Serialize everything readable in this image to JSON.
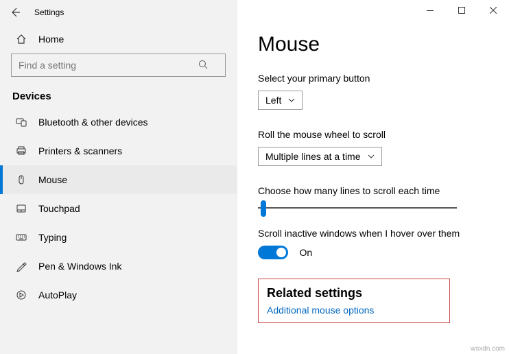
{
  "window": {
    "title": "Settings"
  },
  "sidebar": {
    "home_label": "Home",
    "search_placeholder": "Find a setting",
    "section_header": "Devices",
    "items": [
      {
        "label": "Bluetooth & other devices"
      },
      {
        "label": "Printers & scanners"
      },
      {
        "label": "Mouse"
      },
      {
        "label": "Touchpad"
      },
      {
        "label": "Typing"
      },
      {
        "label": "Pen & Windows Ink"
      },
      {
        "label": "AutoPlay"
      }
    ]
  },
  "content": {
    "heading": "Mouse",
    "primary_button": {
      "label": "Select your primary button",
      "value": "Left"
    },
    "wheel": {
      "label": "Roll the mouse wheel to scroll",
      "value": "Multiple lines at a time"
    },
    "lines": {
      "label": "Choose how many lines to scroll each time"
    },
    "inactive": {
      "label": "Scroll inactive windows when I hover over them",
      "toggle_state": "On"
    },
    "related": {
      "title": "Related settings",
      "link": "Additional mouse options"
    }
  },
  "watermark": "wsxdn.com"
}
